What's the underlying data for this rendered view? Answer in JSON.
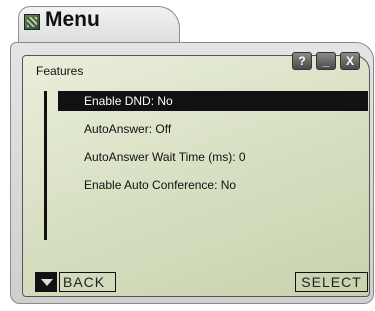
{
  "window": {
    "title": "Menu"
  },
  "controls": {
    "help": "?",
    "minimize": "_",
    "close": "X"
  },
  "screen": {
    "section": "Features",
    "items": [
      {
        "label": "Enable DND: No",
        "selected": true
      },
      {
        "label": "AutoAnswer: Off",
        "selected": false
      },
      {
        "label": "AutoAnswer Wait Time (ms): 0",
        "selected": false
      },
      {
        "label": "Enable Auto Conference: No",
        "selected": false
      }
    ]
  },
  "softkeys": {
    "left": "BACK",
    "right": "SELECT"
  }
}
